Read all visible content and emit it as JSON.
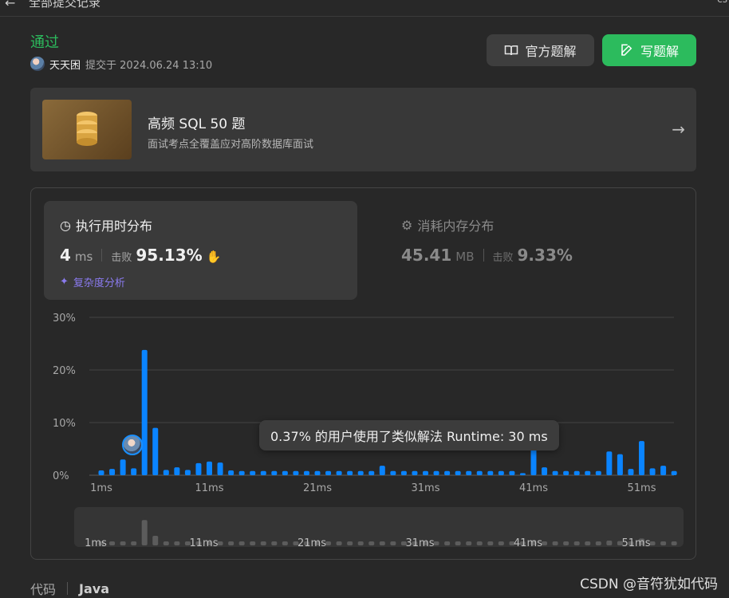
{
  "header": {
    "title": "全部提交记录",
    "corner_text": "cs"
  },
  "submission": {
    "status": "通过",
    "user": "天天困",
    "submitted_label": "提交于 2024.06.24 13:10"
  },
  "actions": {
    "official_solution": "官方题解",
    "write_solution": "写题解"
  },
  "banner": {
    "title": "高频 SQL 50 题",
    "subtitle": "面试考点全覆盖应对高阶数据库面试"
  },
  "runtime": {
    "title": "执行用时分布",
    "value": "4",
    "unit": "ms",
    "beat_label": "击败",
    "beat_value": "95.13%",
    "complexity_link": "复杂度分析"
  },
  "memory": {
    "title": "消耗内存分布",
    "value": "45.41",
    "unit": "MB",
    "beat_label": "击败",
    "beat_value": "9.33%"
  },
  "tooltip": "0.37% 的用户使用了类似解法 Runtime: 30 ms",
  "chart_data": {
    "type": "bar",
    "title": "",
    "xlabel": "",
    "ylabel": "",
    "ylim": [
      0,
      30
    ],
    "y_ticks": [
      "30%",
      "20%",
      "10%",
      "0%"
    ],
    "x_ticks": [
      "1ms",
      "11ms",
      "21ms",
      "31ms",
      "41ms",
      "51ms"
    ],
    "x": [
      1,
      2,
      3,
      4,
      5,
      6,
      7,
      8,
      9,
      10,
      11,
      12,
      13,
      14,
      15,
      16,
      17,
      18,
      19,
      20,
      21,
      22,
      23,
      24,
      25,
      26,
      27,
      28,
      29,
      30,
      31,
      32,
      33,
      34,
      35,
      36,
      37,
      38,
      39,
      40,
      41,
      42,
      43,
      44,
      45,
      46,
      47,
      48,
      49,
      50,
      51,
      52,
      53,
      54
    ],
    "values": [
      0.9,
      1.2,
      3.0,
      1.3,
      23.8,
      9.0,
      1.0,
      1.5,
      1.0,
      2.3,
      2.6,
      2.4,
      0.9,
      0.8,
      0.8,
      0.8,
      0.8,
      0.8,
      0.8,
      0.8,
      0.8,
      0.8,
      0.8,
      0.8,
      0.8,
      0.8,
      1.8,
      0.8,
      0.8,
      0.8,
      0.8,
      0.8,
      0.8,
      0.8,
      0.8,
      0.8,
      0.8,
      0.8,
      0.8,
      0.4,
      5.0,
      1.5,
      0.8,
      0.8,
      0.8,
      0.8,
      0.8,
      4.5,
      4.0,
      1.2,
      6.5,
      1.3,
      1.8,
      0.8
    ],
    "highlight_x": 4,
    "bar_color": "#0a84ff",
    "grid": true
  },
  "navigator": {
    "x_ticks": [
      "1ms",
      "11ms",
      "21ms",
      "31ms",
      "41ms",
      "51ms"
    ]
  },
  "footer": {
    "code_label": "代码",
    "language": "Java",
    "watermark": "CSDN @音符犹如代码"
  },
  "colors": {
    "accent_green": "#2cbb5d",
    "bar_blue": "#0a84ff",
    "complexity_purple": "#8b7bf0"
  }
}
